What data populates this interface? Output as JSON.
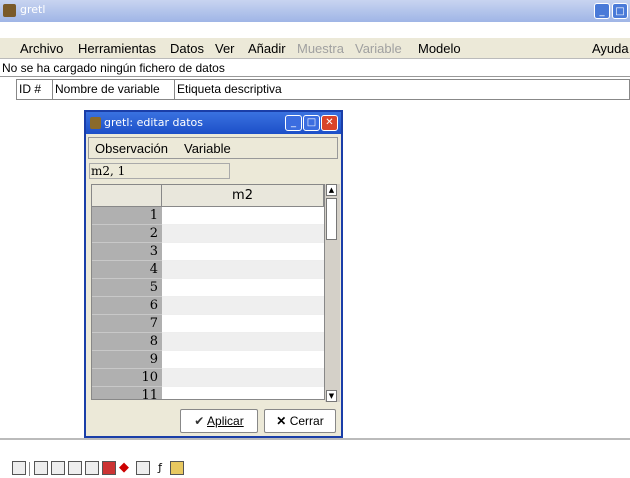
{
  "app": {
    "title": "gretl"
  },
  "window_controls": {
    "minimize": "_",
    "maximize": "□"
  },
  "menubar": {
    "items": [
      {
        "label": "Archivo",
        "disabled": false
      },
      {
        "label": "Herramientas",
        "disabled": false
      },
      {
        "label": "Datos",
        "disabled": false
      },
      {
        "label": "Ver",
        "disabled": false
      },
      {
        "label": "Añadir",
        "disabled": false
      },
      {
        "label": "Muestra",
        "disabled": true
      },
      {
        "label": "Variable",
        "disabled": true
      },
      {
        "label": "Modelo",
        "disabled": false
      }
    ],
    "help": "Ayuda"
  },
  "status": {
    "text": "No se ha cargado ningún fichero de datos"
  },
  "columns": {
    "id": "ID #",
    "name": "Nombre de variable",
    "label": "Etiqueta descriptiva"
  },
  "dialog": {
    "title": "gretl: editar datos",
    "menu": {
      "observacion": "Observación",
      "variable": "Variable"
    },
    "cellref": "m2, 1",
    "column_header": "m2",
    "rows": [
      "1",
      "2",
      "3",
      "4",
      "5",
      "6",
      "7",
      "8",
      "9",
      "10",
      "11"
    ],
    "buttons": {
      "apply": "Aplicar",
      "close": "Cerrar"
    }
  },
  "colors": {
    "title_bar": "#1c4fc8",
    "close_button": "#d9442a",
    "row_number_bg": "#b0b0b0"
  }
}
